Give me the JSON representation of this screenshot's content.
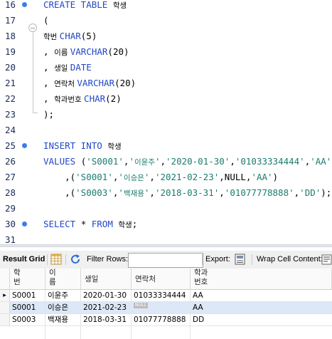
{
  "editor": {
    "lines": [
      {
        "num": "16",
        "dot": true,
        "segs": [
          {
            "c": "kw",
            "t": "CREATE TABLE "
          },
          {
            "c": "ko",
            "t": "학생"
          }
        ]
      },
      {
        "num": "17",
        "dot": false,
        "segs": [
          {
            "c": "",
            "t": "("
          }
        ]
      },
      {
        "num": "18",
        "dot": false,
        "segs": [
          {
            "c": "ko",
            "t": "학번 "
          },
          {
            "c": "typ",
            "t": "CHAR"
          },
          {
            "c": "",
            "t": "(5)"
          }
        ]
      },
      {
        "num": "19",
        "dot": false,
        "segs": [
          {
            "c": "",
            "t": ", "
          },
          {
            "c": "ko",
            "t": "이름 "
          },
          {
            "c": "typ",
            "t": "VARCHAR"
          },
          {
            "c": "",
            "t": "(20)"
          }
        ]
      },
      {
        "num": "20",
        "dot": false,
        "segs": [
          {
            "c": "",
            "t": ", "
          },
          {
            "c": "ko",
            "t": "생일 "
          },
          {
            "c": "typ",
            "t": "DATE"
          }
        ]
      },
      {
        "num": "21",
        "dot": false,
        "segs": [
          {
            "c": "",
            "t": ", "
          },
          {
            "c": "ko",
            "t": "연락처 "
          },
          {
            "c": "typ",
            "t": "VARCHAR"
          },
          {
            "c": "",
            "t": "(20)"
          }
        ]
      },
      {
        "num": "22",
        "dot": false,
        "segs": [
          {
            "c": "",
            "t": ", "
          },
          {
            "c": "ko",
            "t": "학과번호 "
          },
          {
            "c": "typ",
            "t": "CHAR"
          },
          {
            "c": "",
            "t": "(2)"
          }
        ]
      },
      {
        "num": "23",
        "dot": false,
        "segs": [
          {
            "c": "",
            "t": ");"
          }
        ]
      },
      {
        "num": "24",
        "dot": false,
        "segs": []
      },
      {
        "num": "25",
        "dot": true,
        "segs": [
          {
            "c": "kw",
            "t": "INSERT INTO "
          },
          {
            "c": "ko",
            "t": "학생"
          }
        ]
      },
      {
        "num": "26",
        "dot": false,
        "segs": [
          {
            "c": "kw",
            "t": "VALUES "
          },
          {
            "c": "",
            "t": "("
          },
          {
            "c": "str",
            "t": "'S0001'"
          },
          {
            "c": "",
            "t": ","
          },
          {
            "c": "str",
            "t": "'"
          },
          {
            "c": "str ko",
            "t": "이윤주"
          },
          {
            "c": "str",
            "t": "'"
          },
          {
            "c": "",
            "t": ","
          },
          {
            "c": "str",
            "t": "'2020-01-30'"
          },
          {
            "c": "",
            "t": ","
          },
          {
            "c": "str",
            "t": "'01033334444'"
          },
          {
            "c": "",
            "t": ","
          },
          {
            "c": "str",
            "t": "'AA'"
          },
          {
            "c": "",
            "t": ")"
          }
        ]
      },
      {
        "num": "27",
        "dot": false,
        "segs": [
          {
            "c": "",
            "t": "    ,("
          },
          {
            "c": "str",
            "t": "'S0001'"
          },
          {
            "c": "",
            "t": ","
          },
          {
            "c": "str",
            "t": "'"
          },
          {
            "c": "str ko",
            "t": "이승은"
          },
          {
            "c": "str",
            "t": "'"
          },
          {
            "c": "",
            "t": ","
          },
          {
            "c": "str",
            "t": "'2021-02-23'"
          },
          {
            "c": "",
            "t": ",NULL,"
          },
          {
            "c": "str",
            "t": "'AA'"
          },
          {
            "c": "",
            "t": ")"
          }
        ]
      },
      {
        "num": "28",
        "dot": false,
        "segs": [
          {
            "c": "",
            "t": "    ,("
          },
          {
            "c": "str",
            "t": "'S0003'"
          },
          {
            "c": "",
            "t": ","
          },
          {
            "c": "str",
            "t": "'"
          },
          {
            "c": "str ko",
            "t": "백재용"
          },
          {
            "c": "str",
            "t": "'"
          },
          {
            "c": "",
            "t": ","
          },
          {
            "c": "str",
            "t": "'2018-03-31'"
          },
          {
            "c": "",
            "t": ","
          },
          {
            "c": "str",
            "t": "'01077778888'"
          },
          {
            "c": "",
            "t": ","
          },
          {
            "c": "str",
            "t": "'DD'"
          },
          {
            "c": "",
            "t": ");"
          }
        ]
      },
      {
        "num": "29",
        "dot": false,
        "segs": []
      },
      {
        "num": "30",
        "dot": true,
        "segs": [
          {
            "c": "kw",
            "t": "SELECT "
          },
          {
            "c": "",
            "t": "* "
          },
          {
            "c": "kw",
            "t": "FROM "
          },
          {
            "c": "ko",
            "t": "학생"
          },
          {
            "c": "",
            "t": ";"
          }
        ]
      },
      {
        "num": "31",
        "dot": false,
        "segs": []
      }
    ]
  },
  "toolbar": {
    "result_grid": "Result Grid",
    "filter_rows": "Filter Rows:",
    "filter_value": "",
    "export": "Export:",
    "wrap": "Wrap Cell Content:"
  },
  "grid": {
    "headers": [
      {
        "l1": "학",
        "l2": "번"
      },
      {
        "l1": "이",
        "l2": "름"
      },
      {
        "l1": "생일",
        "l2": ""
      },
      {
        "l1": "연락처",
        "l2": ""
      },
      {
        "l1": "학과",
        "l2": "번호"
      }
    ],
    "rows": [
      [
        "S0001",
        "이윤주",
        "2020-01-30",
        "01033334444",
        "AA"
      ],
      [
        "S0001",
        "이승은",
        "2021-02-23",
        null,
        "AA"
      ],
      [
        "S0003",
        "백재용",
        "2018-03-31",
        "01077778888",
        "DD"
      ]
    ],
    "null_label": "NULL",
    "current_row_marker": "▸"
  },
  "colors": {
    "keyword": "#2148c8",
    "string": "#1a7c6e",
    "breakpoint_dot": "#3b7ded",
    "selected_row": "#dce8f7"
  }
}
